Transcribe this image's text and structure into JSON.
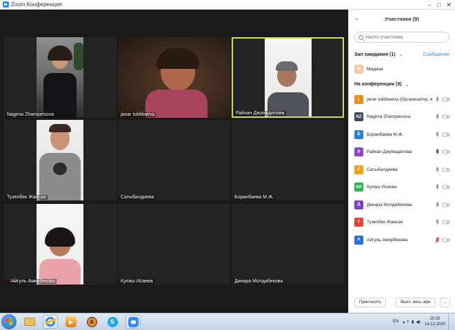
{
  "window": {
    "title": "Zoom Конференция"
  },
  "tiles": [
    {
      "name": "Nagima Zhampeisova",
      "muted": false
    },
    {
      "name": "janar tuktibaeva",
      "muted": false
    },
    {
      "name": "Райхан Джумадилова",
      "muted": false,
      "active": true
    },
    {
      "name": "Тузелбек Жансая",
      "muted": false
    },
    {
      "name": "Сатыбалдиева",
      "muted": false
    },
    {
      "name": "Боранбаева М.Ж.",
      "muted": false
    },
    {
      "name": "Айгуль Амирбекова",
      "muted": true
    },
    {
      "name": "Куляш Исаева",
      "muted": false
    },
    {
      "name": "Динара Молдабекова",
      "muted": false
    }
  ],
  "sidebar": {
    "title": "Участники (9)",
    "search_placeholder": "Найти участника",
    "waiting": {
      "label": "Зал ожидания (1)",
      "message_button": "Сообщение",
      "person": {
        "initials": "М",
        "name": "Мадина",
        "color": "#f7c8a8"
      }
    },
    "in_meeting": {
      "label": "На конференции (9)",
      "participants": [
        {
          "initials": "j",
          "name": "janar tuktibaeva (Организатор, я)",
          "color": "#f08c1a",
          "mic": "on",
          "cam": "off"
        },
        {
          "initials": "NZ",
          "name": "Nagima Zhampeisova",
          "color": "#3b4a5c",
          "mic": "on",
          "cam": "off"
        },
        {
          "initials": "Б",
          "name": "Боранбаева М.Ж.",
          "color": "#2d7fd8",
          "mic": "on",
          "cam": "off"
        },
        {
          "initials": "Р",
          "name": "Райхан Джумадилова",
          "color": "#8e44c4",
          "mic": "talking",
          "cam": "off"
        },
        {
          "initials": "С",
          "name": "Сатыбалдиева",
          "color": "#f0a21a",
          "mic": "on",
          "cam": "off"
        },
        {
          "initials": "КИ",
          "name": "Куляш Исаева",
          "color": "#2fb357",
          "mic": "on",
          "cam": "off"
        },
        {
          "initials": "Д",
          "name": "Динара Молдабекова",
          "color": "#7a3fc2",
          "mic": "on",
          "cam": "off"
        },
        {
          "initials": "Т",
          "name": "Тузелбек Жансая",
          "color": "#e2462f",
          "mic": "on",
          "cam": "off"
        },
        {
          "initials": "А",
          "name": "Айгуль Амирбекова",
          "color": "#2d6fd8",
          "mic": "muted",
          "cam": "off"
        }
      ]
    },
    "footer": {
      "invite": "Пригласить",
      "mute_all": "Выкл. весь звук",
      "more": "..."
    }
  },
  "taskbar": {
    "lang": "EN",
    "time": "20:32",
    "date": "14.12.2020"
  }
}
